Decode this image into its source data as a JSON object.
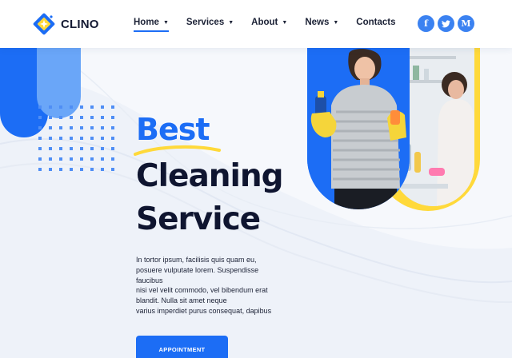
{
  "brand": {
    "name": "CLINO",
    "logo_icon": "diamond-sparkle-icon",
    "accent": "#1c6df5",
    "yellow": "#ffd93a"
  },
  "nav": {
    "items": [
      {
        "label": "Home",
        "has_dropdown": true,
        "active": true
      },
      {
        "label": "Services",
        "has_dropdown": true,
        "active": false
      },
      {
        "label": "About",
        "has_dropdown": true,
        "active": false
      },
      {
        "label": "News",
        "has_dropdown": true,
        "active": false
      },
      {
        "label": "Contacts",
        "has_dropdown": false,
        "active": false
      }
    ]
  },
  "socials": [
    {
      "icon": "facebook-icon",
      "glyph": "f"
    },
    {
      "icon": "twitter-icon",
      "glyph": "t"
    },
    {
      "icon": "medium-icon",
      "glyph": "M"
    }
  ],
  "hero": {
    "headline_accent": "Best",
    "headline_line2": "Cleaning",
    "headline_line3": "Service",
    "description_lines": [
      "In tortor ipsum, facilisis quis quam eu,",
      "posuere vulputate lorem. Suspendisse",
      "faucibus",
      "nisi vel velit commodo, vel bibendum erat",
      "blandit. Nulla sit amet neque",
      "varius imperdiet purus consequat, dapibus"
    ],
    "button_label": "APPOINTMENT"
  }
}
